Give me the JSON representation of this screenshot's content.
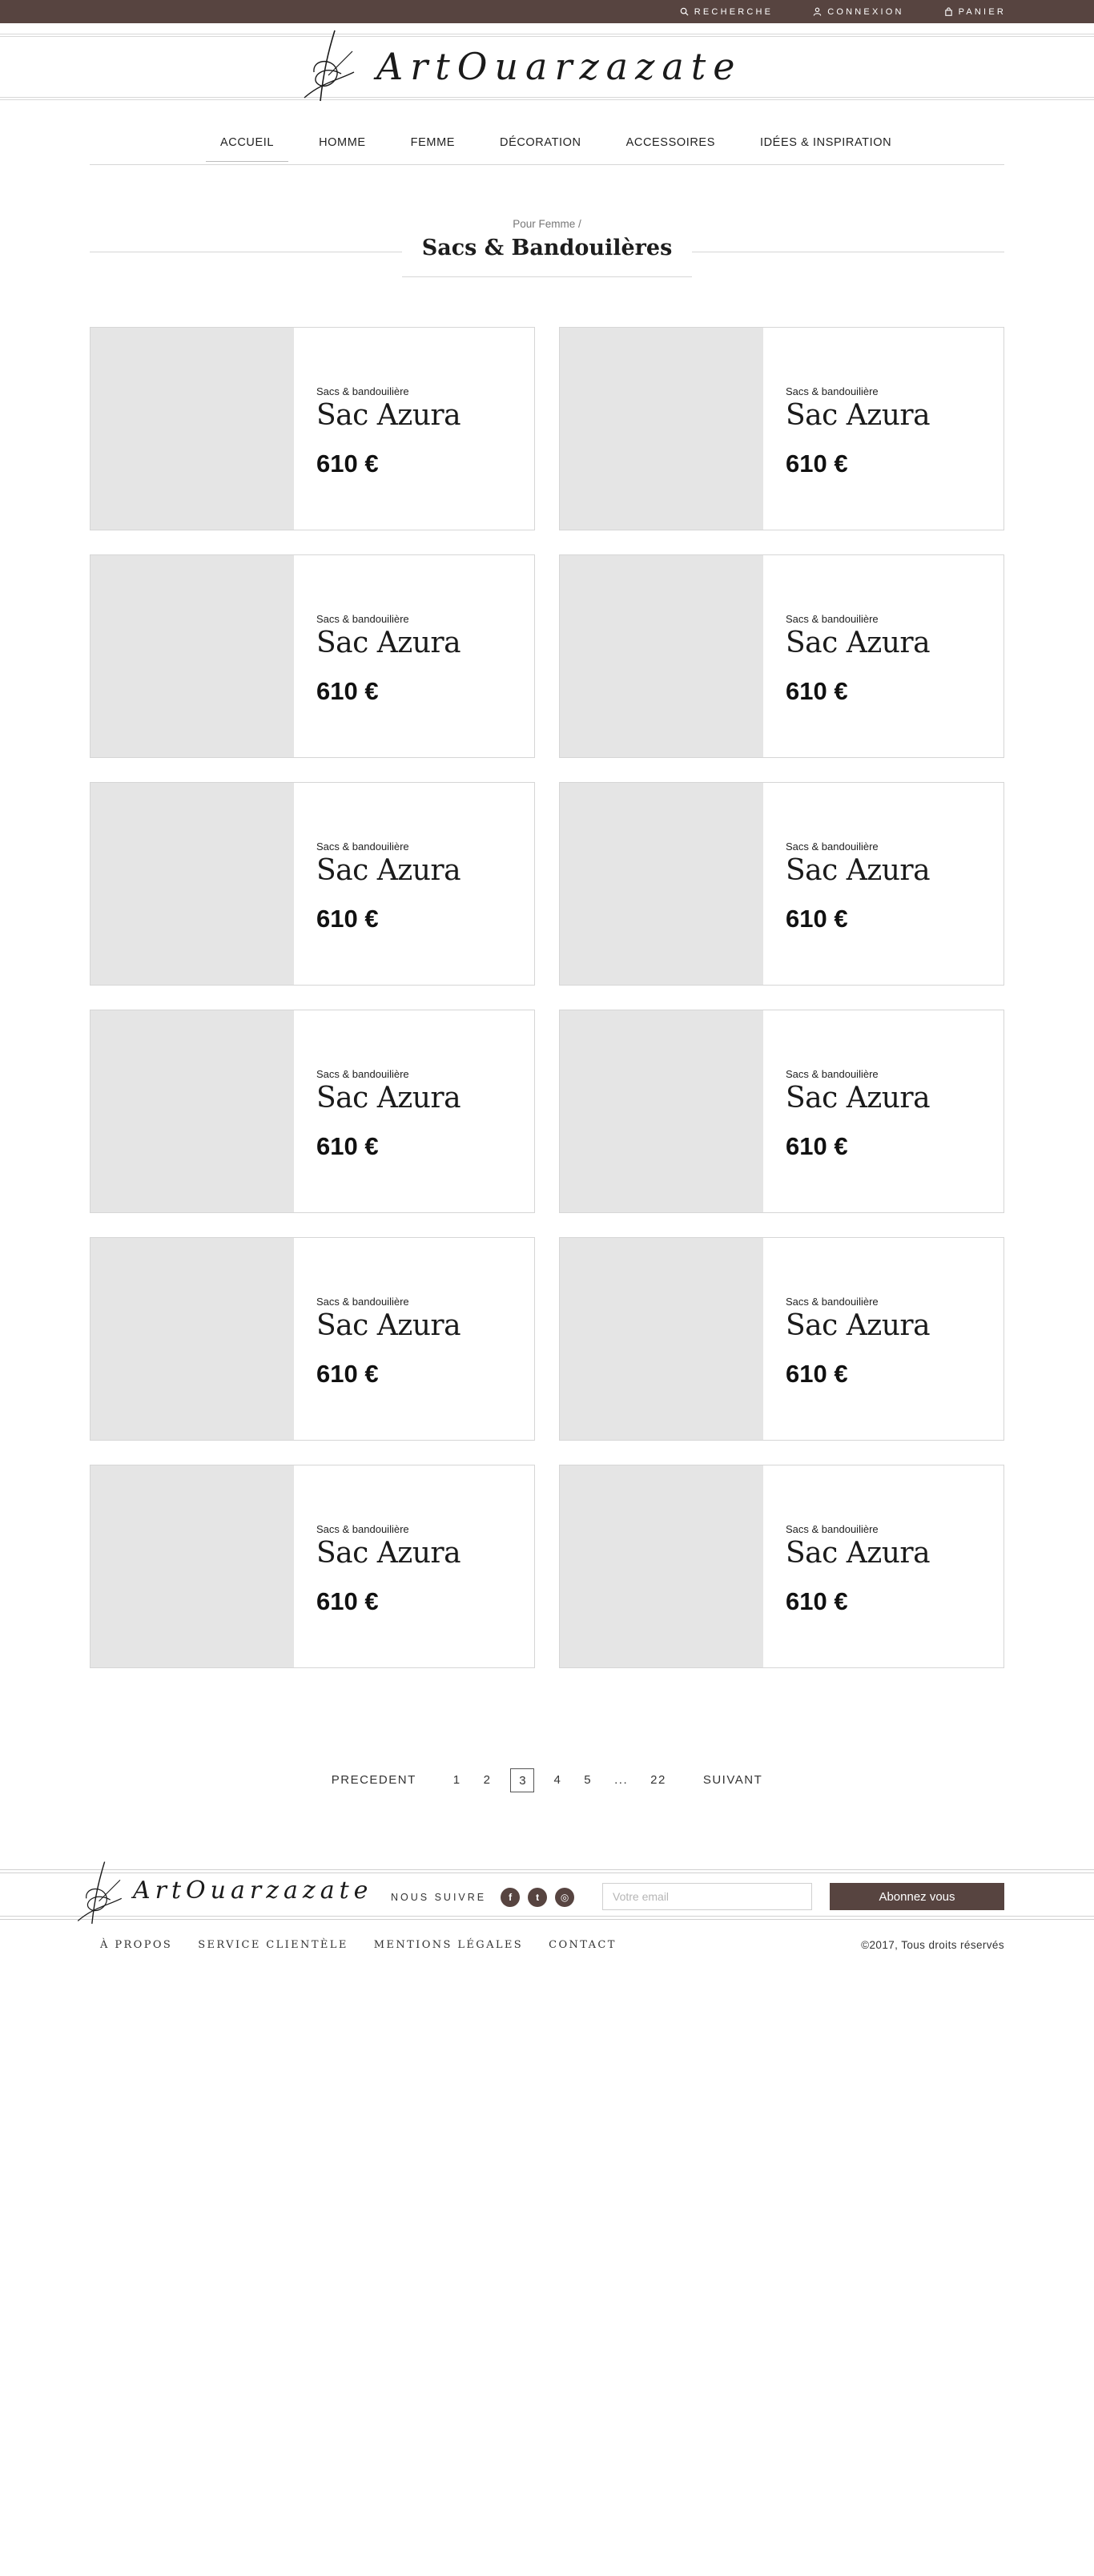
{
  "topbar": {
    "links": [
      {
        "label": "Recherche",
        "icon": "search-icon"
      },
      {
        "label": "Connexion",
        "icon": "user-icon"
      },
      {
        "label": "Panier",
        "icon": "bag-icon"
      }
    ],
    "background": "#574440"
  },
  "brand": {
    "name": "ArtOuarzazate"
  },
  "nav": {
    "items": [
      "Accueil",
      "Homme",
      "Femme",
      "Décoration",
      "Accessoires",
      "Idées & Inspiration"
    ],
    "active": "Accueil"
  },
  "page": {
    "breadcrumb": "Pour Femme /",
    "title": "Sacs & Bandouilères"
  },
  "products": [
    {
      "category": "Sacs & bandouilière",
      "name": "Sac Azura",
      "price": "610 €"
    },
    {
      "category": "Sacs & bandouilière",
      "name": "Sac Azura",
      "price": "610 €"
    },
    {
      "category": "Sacs & bandouilière",
      "name": "Sac Azura",
      "price": "610 €"
    },
    {
      "category": "Sacs & bandouilière",
      "name": "Sac Azura",
      "price": "610 €"
    },
    {
      "category": "Sacs & bandouilière",
      "name": "Sac Azura",
      "price": "610 €"
    },
    {
      "category": "Sacs & bandouilière",
      "name": "Sac Azura",
      "price": "610 €"
    },
    {
      "category": "Sacs & bandouilière",
      "name": "Sac Azura",
      "price": "610 €"
    },
    {
      "category": "Sacs & bandouilière",
      "name": "Sac Azura",
      "price": "610 €"
    },
    {
      "category": "Sacs & bandouilière",
      "name": "Sac Azura",
      "price": "610 €"
    },
    {
      "category": "Sacs & bandouilière",
      "name": "Sac Azura",
      "price": "610 €"
    },
    {
      "category": "Sacs & bandouilière",
      "name": "Sac Azura",
      "price": "610 €"
    },
    {
      "category": "Sacs & bandouilière",
      "name": "Sac Azura",
      "price": "610 €"
    }
  ],
  "pagination": {
    "prev": "Precedent",
    "pages": [
      "1",
      "2",
      "3",
      "4",
      "5",
      "...",
      "22"
    ],
    "current": "3",
    "next": "Suivant"
  },
  "footer": {
    "follow_label": "Nous suivre",
    "social": [
      {
        "icon": "facebook-icon",
        "glyph": "f"
      },
      {
        "icon": "twitter-icon",
        "glyph": "t"
      },
      {
        "icon": "instagram-icon",
        "glyph": "◎"
      }
    ],
    "email_placeholder": "Votre email",
    "subscribe_label": "Abonnez vous",
    "links": [
      "À propos",
      "Service Clientèle",
      "Mentions Légales",
      "Contact"
    ],
    "copyright": "©2017, Tous droits réservés"
  }
}
